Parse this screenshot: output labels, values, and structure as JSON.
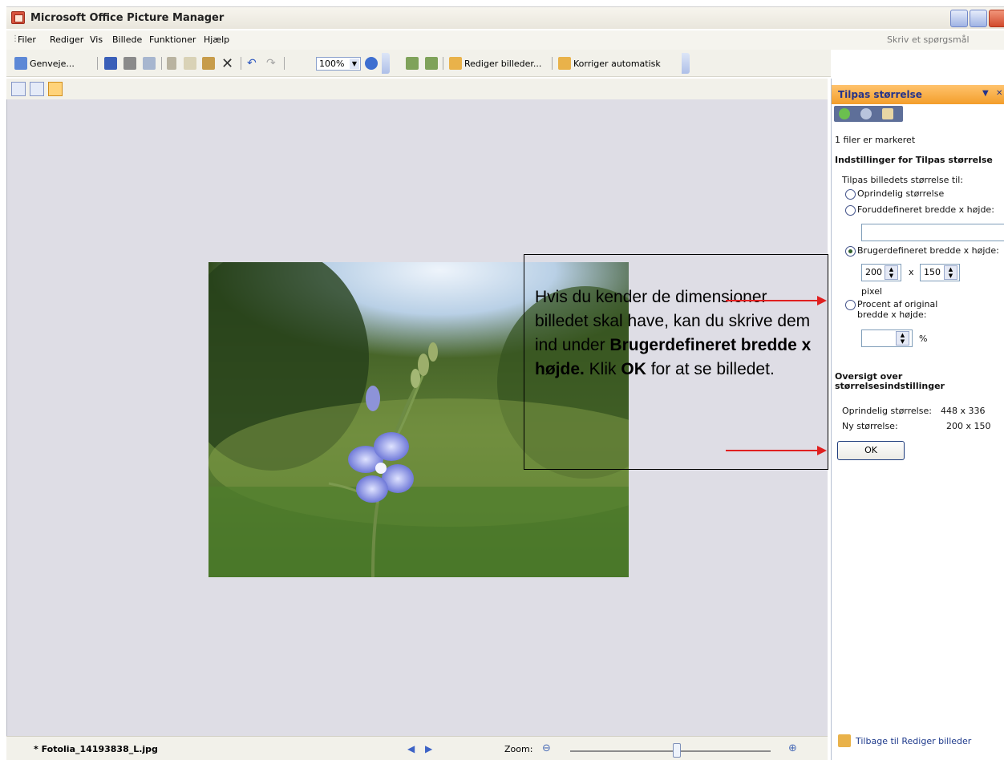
{
  "window": {
    "title": "Microsoft Office Picture Manager"
  },
  "menu": {
    "items": [
      "Filer",
      "Rediger",
      "Vis",
      "Billede",
      "Funktioner",
      "Hjælp"
    ],
    "ask_placeholder": "Skriv et spørgsmål"
  },
  "toolbar": {
    "shortcut_label": "Genveje...",
    "zoom_value": "100%",
    "edit_pictures_label": "Rediger billeder...",
    "auto_correct_label": "Korriger automatisk"
  },
  "callout": {
    "text_parts": [
      "Hvis du kender de dimensioner billedet skal have, kan du skrive dem ind under ",
      "Brugerdefineret bredde x højde.",
      " Klik ",
      "OK",
      " for at se billedet."
    ]
  },
  "status": {
    "filename": "* Fotolia_14193838_L.jpg",
    "zoom_label": "Zoom:",
    "zoom_level": 0.53
  },
  "taskpane": {
    "title": "Tilpas størrelse",
    "files_selected": "1 filer er markeret",
    "settings_heading": "Indstillinger for Tilpas størrelse",
    "resize_to_label": "Tilpas billedets størrelse til:",
    "options": {
      "original": "Oprindelig størrelse",
      "predefined": "Foruddefineret bredde x højde:",
      "custom": "Brugerdefineret bredde x højde:",
      "percent": "Procent af original bredde x højde:"
    },
    "selected_option": "custom",
    "width_value": "200",
    "times": "x",
    "height_value": "150",
    "pixel_label": "pixel",
    "percent_symbol": "%",
    "summary_heading": "Oversigt over størrelsesindstillinger",
    "original_size_label": "Oprindelig størrelse:",
    "original_size_value": "448 x 336",
    "new_size_label": "Ny størrelse:",
    "new_size_value": "200 x 150",
    "ok_label": "OK",
    "back_link": "Tilbage til Rediger billeder"
  }
}
